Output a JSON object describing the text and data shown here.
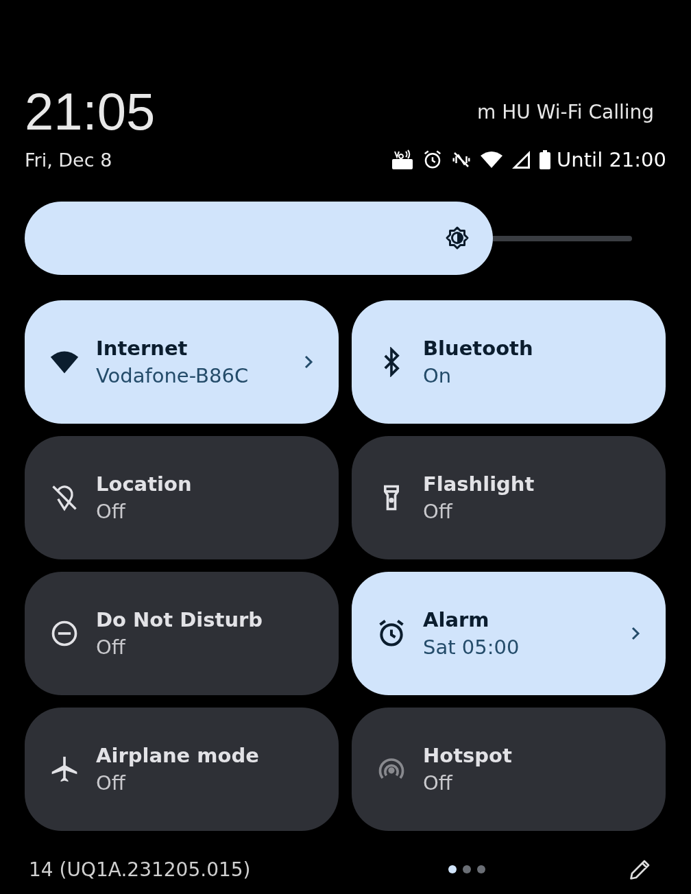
{
  "header": {
    "time": "21:05",
    "carrier": "m HU Wi-Fi Calling",
    "date": "Fri, Dec 8",
    "battery_text": "Until 21:00"
  },
  "brightness": {
    "level": 0.73
  },
  "tiles": [
    {
      "kind": "wifi",
      "label": "Internet",
      "status": "Vodafone-B86C",
      "on": true,
      "chevron": true,
      "disabled": false
    },
    {
      "kind": "bluetooth",
      "label": "Bluetooth",
      "status": "On",
      "on": true,
      "chevron": false,
      "disabled": false
    },
    {
      "kind": "location",
      "label": "Location",
      "status": "Off",
      "on": false,
      "chevron": false,
      "disabled": false
    },
    {
      "kind": "flashlight",
      "label": "Flashlight",
      "status": "Off",
      "on": false,
      "chevron": false,
      "disabled": false
    },
    {
      "kind": "dnd",
      "label": "Do Not Disturb",
      "status": "Off",
      "on": false,
      "chevron": false,
      "disabled": false
    },
    {
      "kind": "alarm",
      "label": "Alarm",
      "status": "Sat 05:00",
      "on": true,
      "chevron": true,
      "disabled": false
    },
    {
      "kind": "airplane",
      "label": "Airplane mode",
      "status": "Off",
      "on": false,
      "chevron": false,
      "disabled": false
    },
    {
      "kind": "hotspot",
      "label": "Hotspot",
      "status": "Off",
      "on": false,
      "chevron": false,
      "disabled": true
    }
  ],
  "footer": {
    "build": "14 (UQ1A.231205.015)",
    "pages": [
      {
        "selected": true
      },
      {
        "selected": false
      },
      {
        "selected": false
      }
    ]
  }
}
